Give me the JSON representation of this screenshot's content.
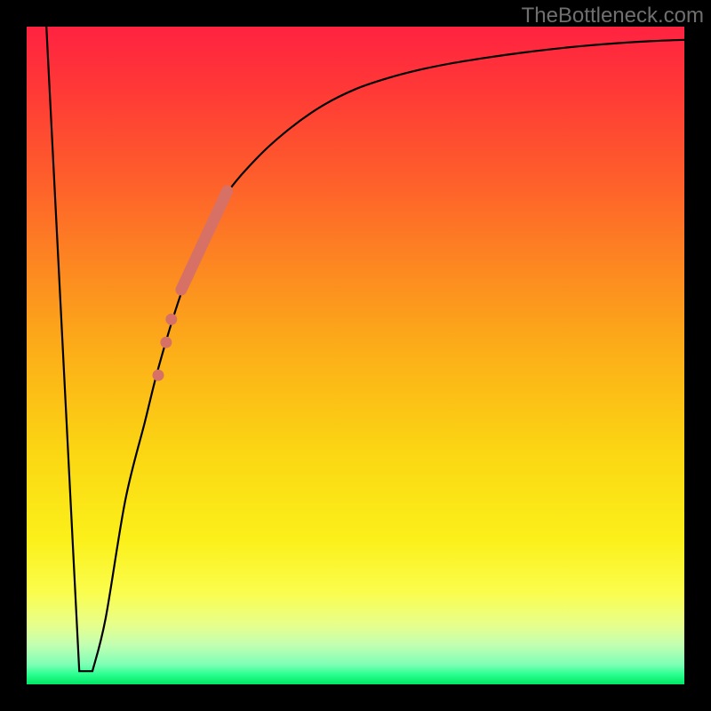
{
  "watermark_text": "TheBottleneck.com",
  "gradient_stops": [
    {
      "offset": 0.0,
      "color": "#ff2241"
    },
    {
      "offset": 0.1,
      "color": "#ff3a36"
    },
    {
      "offset": 0.22,
      "color": "#fe5b2c"
    },
    {
      "offset": 0.35,
      "color": "#fd8322"
    },
    {
      "offset": 0.5,
      "color": "#fcb018"
    },
    {
      "offset": 0.65,
      "color": "#fbd713"
    },
    {
      "offset": 0.78,
      "color": "#fbf01a"
    },
    {
      "offset": 0.86,
      "color": "#fbfd4d"
    },
    {
      "offset": 0.91,
      "color": "#e7ff8c"
    },
    {
      "offset": 0.94,
      "color": "#c2ffb2"
    },
    {
      "offset": 0.97,
      "color": "#7dffb5"
    },
    {
      "offset": 0.985,
      "color": "#2aff8f"
    },
    {
      "offset": 1.0,
      "color": "#00e765"
    }
  ],
  "chart_data": {
    "type": "line",
    "title": "",
    "xlabel": "",
    "ylabel": "",
    "xlim": [
      0,
      100
    ],
    "ylim": [
      0,
      100
    ],
    "series": [
      {
        "name": "bottleneck-curve",
        "x": [
          3,
          8,
          10,
          12,
          15,
          18,
          20,
          23,
          26,
          30,
          35,
          40,
          45,
          50,
          55,
          60,
          65,
          70,
          75,
          80,
          85,
          90,
          95,
          100
        ],
        "y": [
          100,
          2,
          2,
          10,
          28,
          40,
          48,
          58,
          66,
          74,
          80,
          84.5,
          88,
          90.5,
          92.2,
          93.5,
          94.5,
          95.3,
          96,
          96.6,
          97.1,
          97.5,
          97.8,
          98
        ]
      }
    ],
    "highlight_segment": {
      "name": "gpu-range-highlight",
      "x": [
        23.5,
        30.5
      ],
      "y": [
        60,
        75
      ]
    },
    "highlight_dots": [
      {
        "x": 21.2,
        "y": 52
      },
      {
        "x": 22.0,
        "y": 55.5
      },
      {
        "x": 20.0,
        "y": 47
      }
    ]
  }
}
